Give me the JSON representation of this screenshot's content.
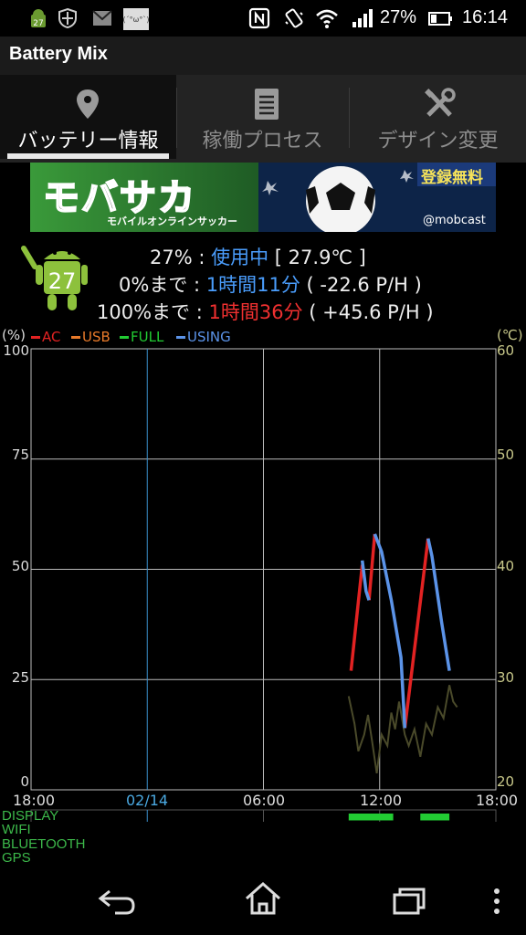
{
  "status_bar": {
    "notif_badge": "27",
    "battery_pct": "27%",
    "time": "16:14",
    "face_text": "(´°ω°`)"
  },
  "app": {
    "title": "Battery Mix"
  },
  "tabs": [
    {
      "label": "バッテリー情報",
      "icon": "location-pin-icon",
      "active": true
    },
    {
      "label": "稼働プロセス",
      "icon": "list-document-icon",
      "active": false
    },
    {
      "label": "デザイン変更",
      "icon": "tools-icon",
      "active": false
    }
  ],
  "banner": {
    "title": "モバサカ",
    "subtitle": "モバイルオンラインサッカー",
    "badge": "登録無料",
    "brand": "@mobcast"
  },
  "battery": {
    "level_badge": "27",
    "line1": {
      "pct": "27%",
      "sep": " : ",
      "state": "使用中",
      "temp": " [ 27.9℃ ]"
    },
    "line2": {
      "label": "0%まで",
      "sep": " : ",
      "duration": "1時間11分",
      "rate": " ( -22.6 P/H )"
    },
    "line3": {
      "label": "100%まで",
      "sep": " : ",
      "duration": "1時間36分",
      "rate": " ( +45.6 P/H )"
    }
  },
  "legend": [
    {
      "label": "AC",
      "color": "#e22222"
    },
    {
      "label": "USB",
      "color": "#e87a2a"
    },
    {
      "label": "FULL",
      "color": "#22cc33"
    },
    {
      "label": "USING",
      "color": "#5b93e8"
    }
  ],
  "axes": {
    "left_unit": "(%)",
    "right_unit": "(℃)",
    "left_ticks": [
      "100",
      "75",
      "50",
      "25",
      "0"
    ],
    "right_ticks": [
      "60",
      "50",
      "40",
      "30",
      "20"
    ],
    "x_ticks": [
      "18:00",
      "02/14",
      "06:00",
      "12:00",
      "18:00"
    ]
  },
  "chart_data": {
    "type": "line",
    "title": "",
    "xlabel": "",
    "ylabel": "(%)",
    "y2label": "(℃)",
    "ylim": [
      0,
      100
    ],
    "y2lim": [
      20,
      60
    ],
    "x_unit": "hours since 18:00",
    "xlim": [
      0,
      24
    ],
    "x_tick_labels": [
      "18:00",
      "02/14",
      "06:00",
      "12:00",
      "18:00"
    ],
    "series": [
      {
        "name": "AC",
        "color": "#e22222",
        "segments": [
          [
            [
              16.52,
              27
            ],
            [
              17.1,
              51
            ]
          ],
          [
            [
              17.45,
              43
            ],
            [
              17.75,
              58
            ]
          ],
          [
            [
              19.3,
              14
            ],
            [
              20.5,
              57
            ]
          ]
        ]
      },
      {
        "name": "USING",
        "color": "#5b93e8",
        "segments": [
          [
            [
              17.1,
              52
            ],
            [
              17.3,
              45
            ],
            [
              17.45,
              43
            ]
          ],
          [
            [
              17.75,
              58
            ],
            [
              18.1,
              54
            ],
            [
              18.6,
              43
            ],
            [
              19.1,
              30
            ],
            [
              19.3,
              14
            ]
          ],
          [
            [
              20.5,
              57
            ],
            [
              20.7,
              53
            ],
            [
              21.2,
              38
            ],
            [
              21.6,
              27
            ]
          ]
        ]
      },
      {
        "name": "Temperature",
        "color": "#4a4a2a",
        "axis": "right",
        "points": [
          [
            16.4,
            28.5
          ],
          [
            16.7,
            26.0
          ],
          [
            16.9,
            23.5
          ],
          [
            17.2,
            25.0
          ],
          [
            17.4,
            26.8
          ],
          [
            17.6,
            24.5
          ],
          [
            17.85,
            21.5
          ],
          [
            18.1,
            25.0
          ],
          [
            18.4,
            24.0
          ],
          [
            18.6,
            27.0
          ],
          [
            18.8,
            25.5
          ],
          [
            19.0,
            28.0
          ],
          [
            19.3,
            25.0
          ],
          [
            19.5,
            24.0
          ],
          [
            19.8,
            25.5
          ],
          [
            20.1,
            23.0
          ],
          [
            20.4,
            26.0
          ],
          [
            20.7,
            25.0
          ],
          [
            21.0,
            27.5
          ],
          [
            21.3,
            26.5
          ],
          [
            21.6,
            29.5
          ],
          [
            21.8,
            28.0
          ],
          [
            22.0,
            27.5
          ]
        ]
      }
    ],
    "grid": true,
    "cursor_line_x": 6
  },
  "lanes": [
    {
      "label": "DISPLAY",
      "color": "#22cc33",
      "on": [
        [
          16.4,
          18.7
        ],
        [
          20.1,
          21.6
        ]
      ]
    },
    {
      "label": "WIFI",
      "color": "#22cc33",
      "on": [
        [
          21.5,
          21.6
        ]
      ]
    },
    {
      "label": "BLUETOOTH",
      "color": "#22cc33",
      "on": []
    },
    {
      "label": "GPS",
      "color": "#22cc33",
      "on": []
    }
  ],
  "nav": {
    "back": "back-icon",
    "home": "home-icon",
    "recents": "recents-icon",
    "menu": "overflow-menu-icon"
  }
}
